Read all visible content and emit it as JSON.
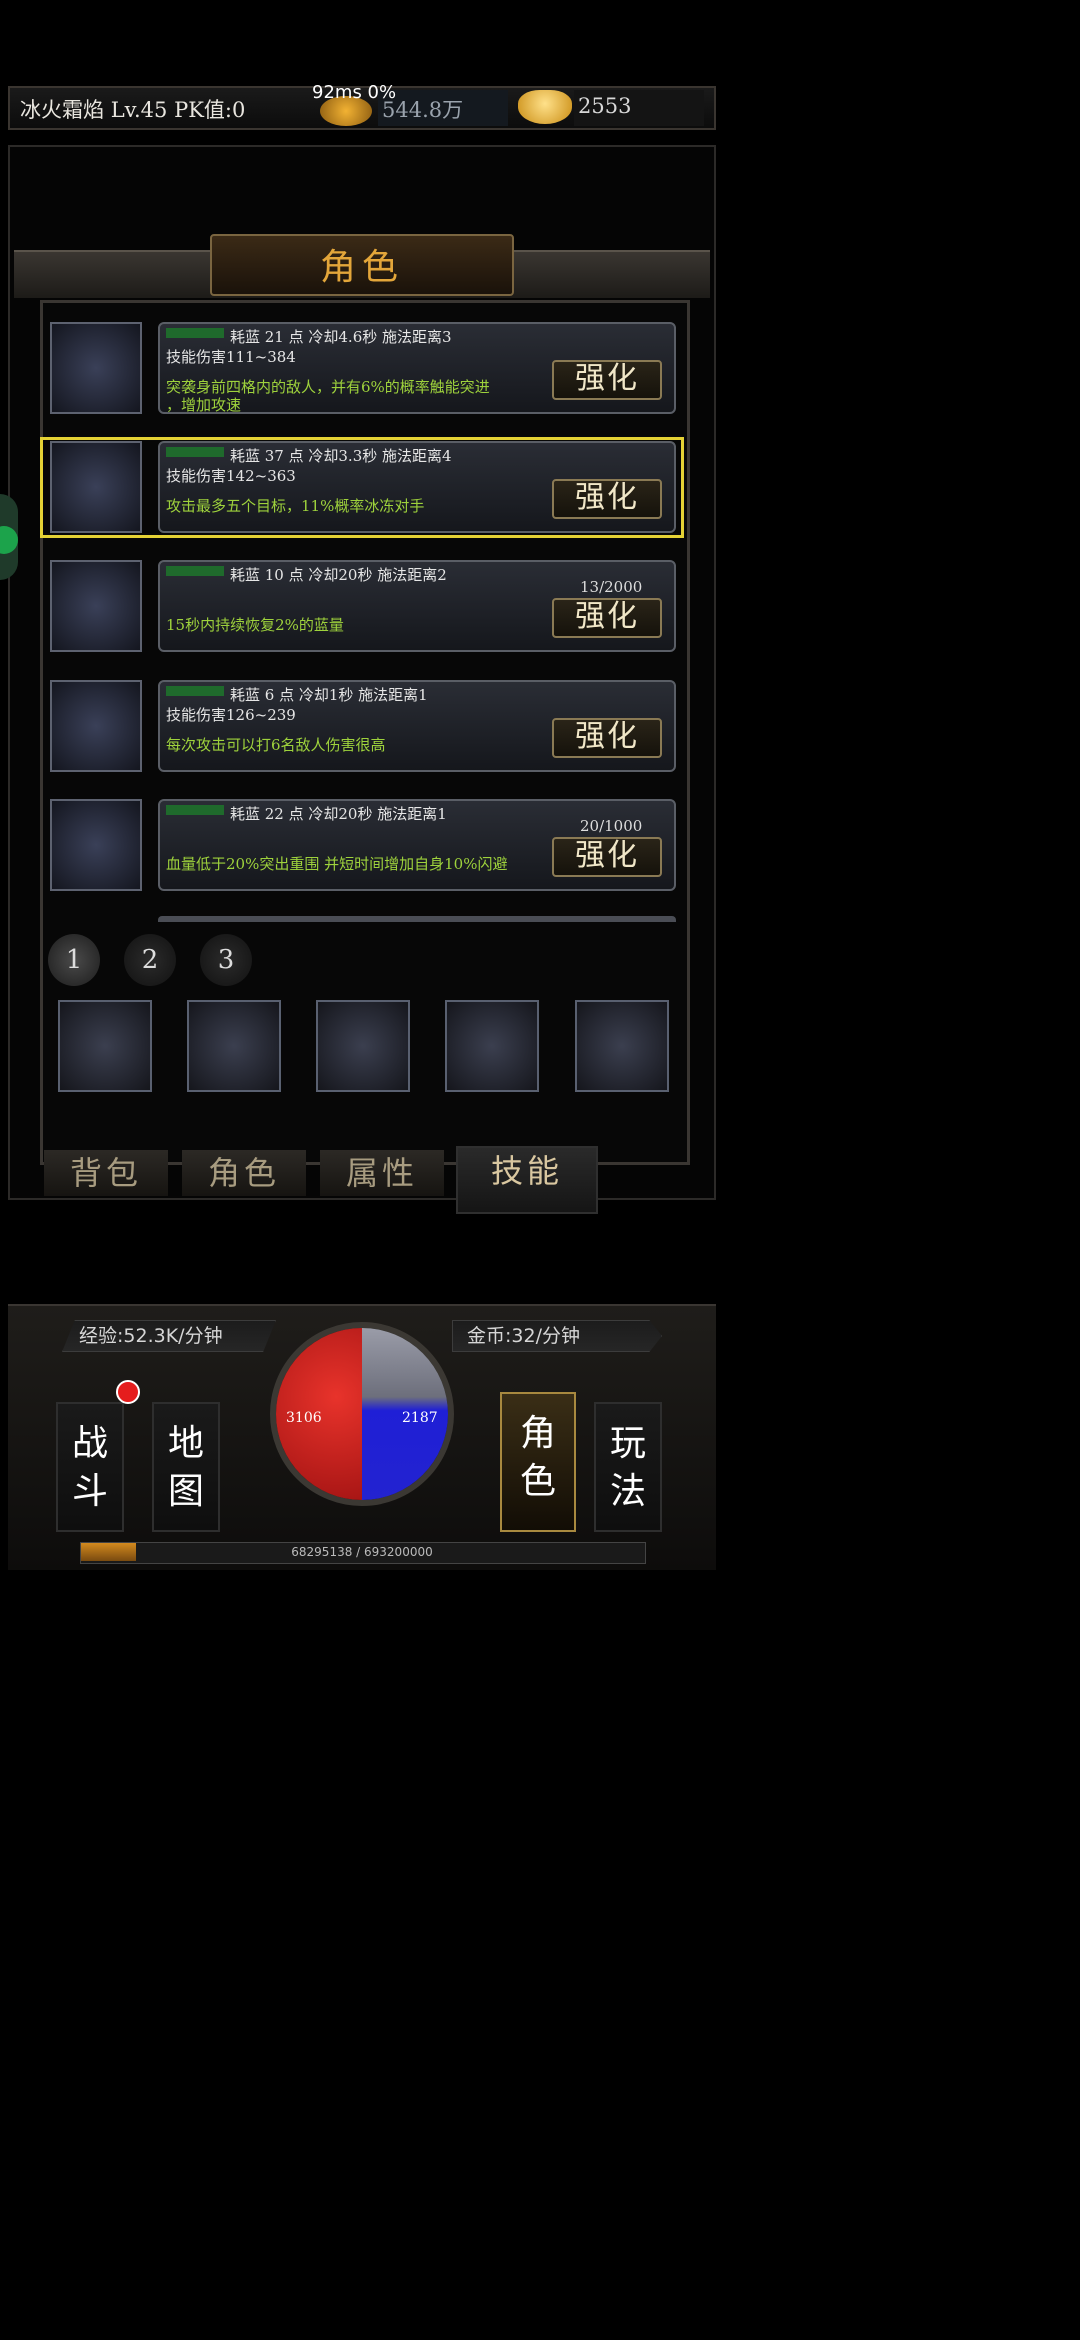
{
  "header": {
    "player_name": "冰火霜焰",
    "level": "Lv.45",
    "pk": "PK值:0",
    "perf": "92ms  0%",
    "gold": "544.8万",
    "ingot": "2553"
  },
  "panel_title": "角色",
  "skills": [
    {
      "top": "耗蓝 21 点 冷却4.6秒  施法距离3",
      "dmg": "技能伤害111~384",
      "desc": "突袭身前四格内的敌人，并有6%的概率触能突进",
      "desc2": "，增加攻速",
      "progress": "",
      "button": "强化",
      "icon": "sword-arrow-icon"
    },
    {
      "top": "耗蓝 37 点 冷却3.3秒  施法距离4",
      "dmg": "技能伤害142~363",
      "desc": "攻击最多五个目标，11%概率冰冻对手",
      "desc2": "",
      "progress": "",
      "button": "强化",
      "icon": "snowflake-icon"
    },
    {
      "top": "耗蓝 10 点 冷却20秒  施法距离2",
      "dmg": "",
      "desc": "15秒内持续恢复2%的蓝量",
      "desc2": "",
      "progress": "13/2000",
      "button": "强化",
      "icon": "crystals-icon"
    },
    {
      "top": "耗蓝 6 点  冷却1秒 施法距离1",
      "dmg": "技能伤害126~239",
      "desc": "每次攻击可以打6名敌人伤害很高",
      "desc2": "",
      "progress": "",
      "button": "强化",
      "icon": "slash-sword-icon"
    },
    {
      "top": "耗蓝 22 点 冷却20秒  施法距离1",
      "dmg": "",
      "desc": "血量低于20%突出重围 并短时间增加自身10%闪避",
      "desc2": "",
      "progress": "20/1000",
      "button": "强化",
      "icon": "cross-blades-icon"
    }
  ],
  "pages": [
    "1",
    "2",
    "3"
  ],
  "equipped": [
    "sword-down-icon",
    "lightning-icon",
    "claw-icon",
    "fire-icon",
    "snowflake-icon"
  ],
  "tabs": [
    "背包",
    "角色",
    "属性",
    "技能"
  ],
  "hud": {
    "exp_rate": "经验:52.3K/分钟",
    "gold_rate": "金币:32/分钟",
    "hp": "3106",
    "mp": "2187",
    "exp_text": "68295138 / 693200000",
    "exp_fraction": 0.0985,
    "nav": [
      {
        "label_top": "战",
        "label_bottom": "斗"
      },
      {
        "label_top": "地",
        "label_bottom": "图"
      },
      {
        "label_top": "角",
        "label_bottom": "色"
      },
      {
        "label_top": "玩",
        "label_bottom": "法"
      }
    ]
  },
  "colors": {
    "accent_gold": "#e3a63a",
    "desc_green": "#9ed23c",
    "select_yellow": "#e5d235",
    "hp_red": "#e8332b",
    "mp_blue": "#2323d0"
  }
}
